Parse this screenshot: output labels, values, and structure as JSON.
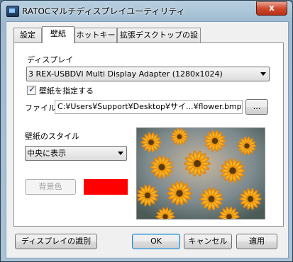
{
  "window": {
    "title": "RATOCマルチディスプレイユーティリティ",
    "close_glyph": "x"
  },
  "tabs": [
    {
      "label": "設定",
      "active": false
    },
    {
      "label": "壁紙",
      "active": true
    },
    {
      "label": "ホットキー",
      "active": false
    },
    {
      "label": "拡張デスクトップの設定",
      "active": false
    }
  ],
  "wallpaper": {
    "display_label": "ディスプレイ",
    "display_value": "3 REX-USBDVI Multi Display Adapter (1280x1024)",
    "specify_checkbox_label": "壁紙を指定する",
    "specify_checked": true,
    "file_label": "ファイル",
    "file_path": "C:¥Users¥Support¥Desktop¥サイ...¥flower.bmp",
    "browse_label": "...",
    "style_label": "壁紙のスタイル",
    "style_value": "中央に表示",
    "bgcolor_label": "背景色",
    "bgcolor_value": "#ff0000",
    "preview_image": "orange-flowers-photo"
  },
  "buttons": {
    "identify": "ディスプレイの識別",
    "ok": "OK",
    "cancel": "キャンセル",
    "apply": "適用"
  }
}
